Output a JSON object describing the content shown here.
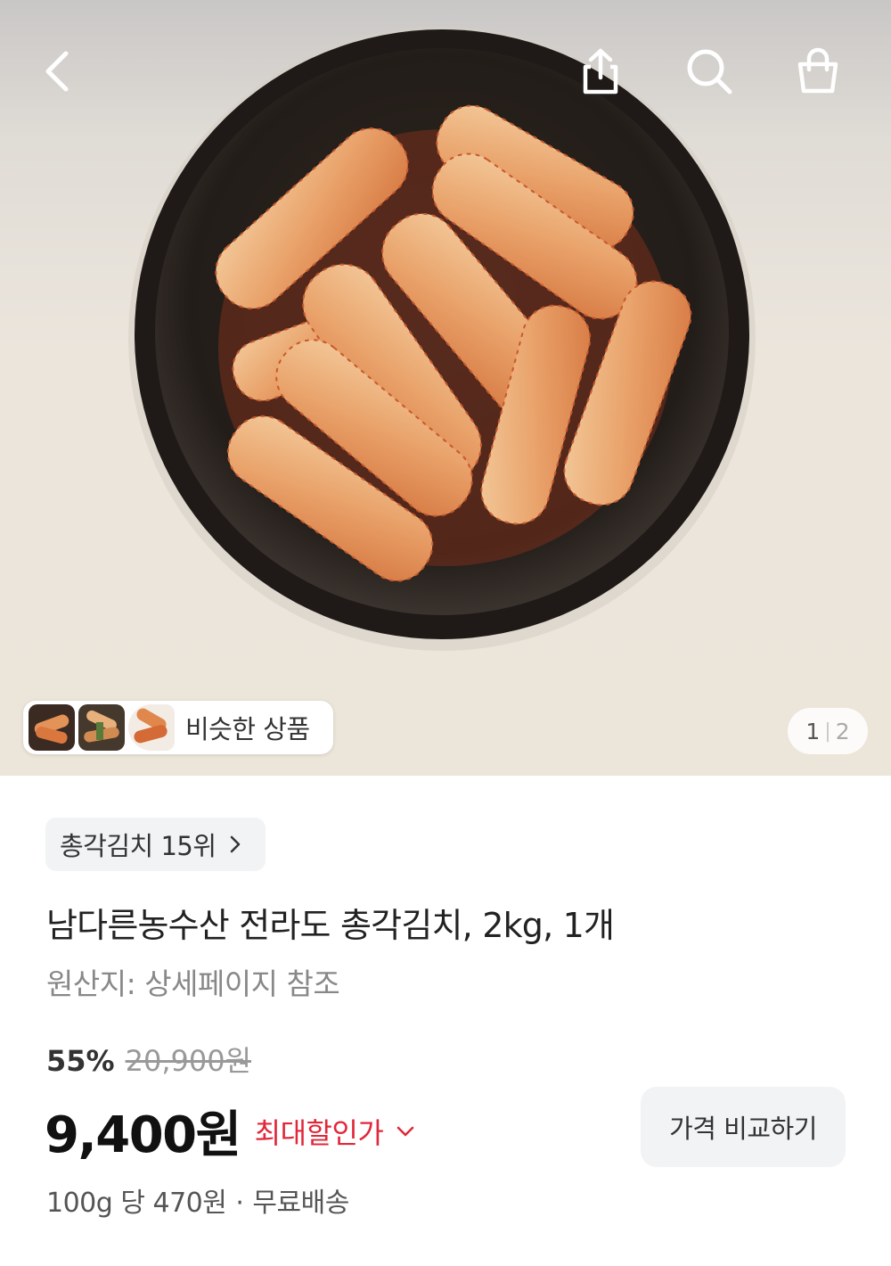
{
  "hero": {
    "similar_label": "비슷한 상품",
    "pager_current": "1",
    "pager_total": "2"
  },
  "product": {
    "rank": "총각김치 15위",
    "title": "남다른농수산 전라도 총각김치, 2kg, 1개",
    "origin": "원산지: 상세페이지 참조",
    "discount_rate": "55%",
    "original_price": "20,900원",
    "price": "9,400원",
    "max_discount_label": "최대할인가",
    "compare_label": "가격 비교하기",
    "unit_price": "100g 당 470원",
    "shipping": "무료배송"
  },
  "colors": {
    "discount_red": "#e0283a",
    "chip_bg": "#f1f3f5"
  },
  "icons": [
    "back-icon",
    "share-icon",
    "search-icon",
    "cart-icon",
    "chevron-right-icon",
    "chevron-down-icon"
  ]
}
